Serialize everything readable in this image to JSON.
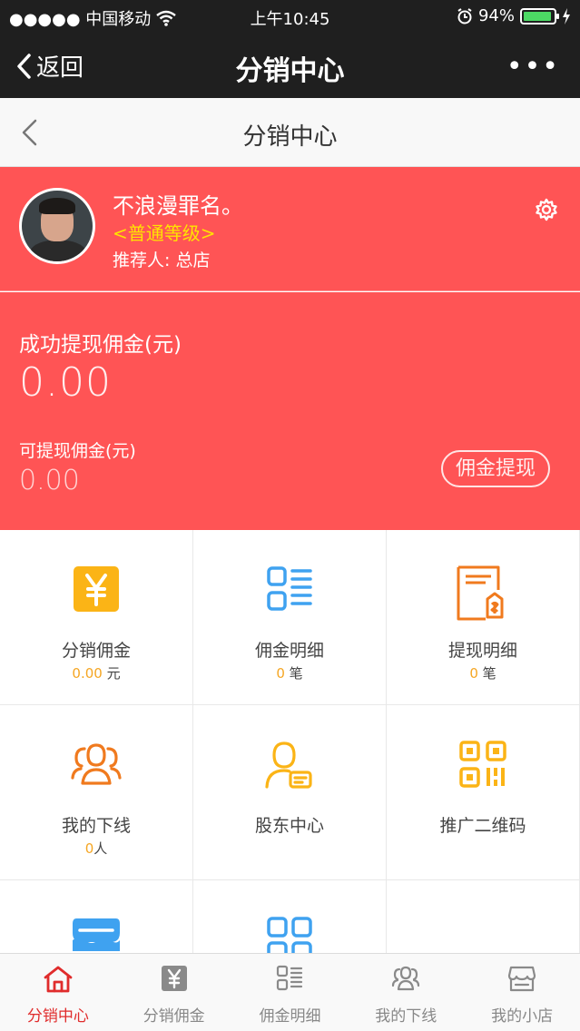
{
  "status_bar": {
    "carrier": "●●●●● 中国移动",
    "time": "上午10:45",
    "battery": "94%",
    "battery_level": 0.94
  },
  "nav": {
    "back_label": "返回",
    "title": "分销中心",
    "more": "•••"
  },
  "sub_header": {
    "title": "分销中心"
  },
  "profile": {
    "name": "不浪漫罪名。",
    "level": "<普通等级>",
    "referrer": "推荐人: 总店"
  },
  "earnings": {
    "success_label": "成功提现佣金(元)",
    "success_value": "0.00",
    "available_label": "可提现佣金(元)",
    "available_value": "0.00",
    "withdraw_button": "佣金提现"
  },
  "grid": [
    {
      "label": "分销佣金",
      "num": "0.00",
      "unit": " 元",
      "icon": "yuan-card-icon"
    },
    {
      "label": "佣金明细",
      "num": "0",
      "unit": " 笔",
      "icon": "list-icon"
    },
    {
      "label": "提现明细",
      "num": "0",
      "unit": " 笔",
      "icon": "receipt-icon"
    },
    {
      "label": "我的下线",
      "num": "0",
      "unit": "人",
      "icon": "team-icon"
    },
    {
      "label": "股东中心",
      "num": "",
      "unit": "",
      "icon": "shareholder-icon"
    },
    {
      "label": "推广二维码",
      "num": "",
      "unit": "",
      "icon": "qrcode-icon"
    },
    {
      "label": "",
      "num": "",
      "unit": "",
      "icon": "shop-icon"
    },
    {
      "label": "",
      "num": "",
      "unit": "",
      "icon": "grid-icon"
    }
  ],
  "tabbar": [
    {
      "label": "分销中心",
      "icon": "home-icon",
      "active": true
    },
    {
      "label": "分销佣金",
      "icon": "yuan-icon",
      "active": false
    },
    {
      "label": "佣金明细",
      "icon": "list-icon",
      "active": false
    },
    {
      "label": "我的下线",
      "icon": "team-icon",
      "active": false
    },
    {
      "label": "我的小店",
      "icon": "store-icon",
      "active": false
    }
  ],
  "colors": {
    "header_bg": "#1f1f1f",
    "accent_red": "#ff5455",
    "level_yellow": "#ffe400",
    "number_orange": "#f5a623",
    "tab_active": "#e02c2c"
  }
}
